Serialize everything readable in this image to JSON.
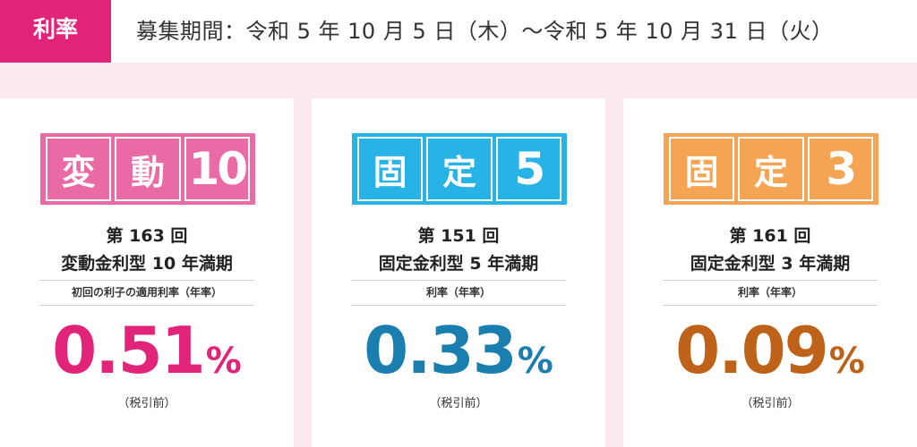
{
  "header": {
    "tag": "利率",
    "period": "募集期間：令和 5 年 10 月 5 日（木）～令和 5 年 10 月 31 日（火）"
  },
  "cards": [
    {
      "badge": [
        "変",
        "動",
        "10"
      ],
      "round": "第 163 回",
      "name": "変動金利型 10 年満期",
      "rate_label": "初回の利子の適用利率（年率）",
      "rate_value": "0.51",
      "rate_unit": "%",
      "tax_note": "（税引前）",
      "color": "#e2237a",
      "badge_color": "#e96aa4"
    },
    {
      "badge": [
        "固",
        "定",
        "5"
      ],
      "round": "第 151 回",
      "name": "固定金利型 5 年満期",
      "rate_label": "利率（年率）",
      "rate_value": "0.33",
      "rate_unit": "%",
      "tax_note": "（税引前）",
      "color": "#1a7fae",
      "badge_color": "#27b3e6"
    },
    {
      "badge": [
        "固",
        "定",
        "3"
      ],
      "round": "第 161 回",
      "name": "固定金利型 3 年満期",
      "rate_label": "利率（年率）",
      "rate_value": "0.09",
      "rate_unit": "%",
      "tax_note": "（税引前）",
      "color": "#bd6218",
      "badge_color": "#f4a452"
    }
  ]
}
